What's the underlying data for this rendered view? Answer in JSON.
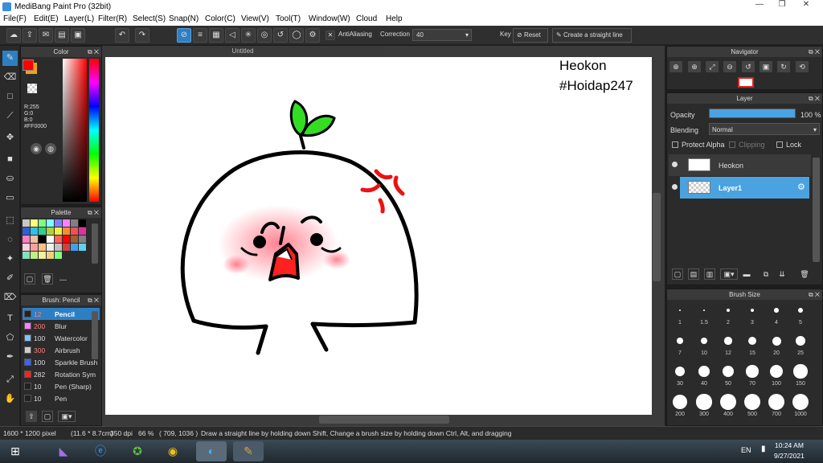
{
  "window": {
    "title": "MediBang Paint Pro (32bit)"
  },
  "menu": [
    "File(F)",
    "Edit(E)",
    "Layer(L)",
    "Filter(R)",
    "Select(S)",
    "Snap(N)",
    "Color(C)",
    "View(V)",
    "Tool(T)",
    "Window(W)",
    "Cloud",
    "Help"
  ],
  "toolbar": {
    "antialiasing": "AntiAliasing",
    "correction_label": "Correction",
    "correction_value": "40",
    "key": "Key",
    "reset": "Reset",
    "straight": "Create a straight line"
  },
  "color_panel": {
    "title": "Color",
    "r": "R:255",
    "g": "G:0",
    "b": "B:0",
    "hex": "#FF0000",
    "primary": "#ff0000",
    "secondary": "#f0a020"
  },
  "palette_panel": {
    "title": "Palette",
    "swatches": [
      "#c8c8c8",
      "#ffff80",
      "#80ff80",
      "#80ffff",
      "#8080ff",
      "#ff80ff",
      "#808080",
      "#000000",
      "#3060d0",
      "#30c0f0",
      "#30d090",
      "#b0d040",
      "#f0f040",
      "#f09030",
      "#f05050",
      "#e030a0",
      "#ff80c0",
      "#f0c0a0",
      "#000000",
      "#ffffff",
      "#ff6060",
      "#ff0000",
      "#a06030",
      "#808080",
      "#ffd0e0",
      "#ffa0a0",
      "#ffc080",
      "#f0f0f0",
      "#c0c0c0",
      "#d04040",
      "#40a0f0",
      "#60d0f0",
      "#80e0c0",
      "#c0f080",
      "#f0f0a0",
      "#f0d080",
      "#80ff80"
    ],
    "dash": "---"
  },
  "brush_panel": {
    "title": "Brush: Pencil",
    "brushes": [
      {
        "size": "12",
        "name": "Pencil",
        "color": "#222222"
      },
      {
        "size": "200",
        "name": "Blur",
        "color": "#ff80ff"
      },
      {
        "size": "100",
        "name": "Watercolor",
        "color": "#80c0ff"
      },
      {
        "size": "300",
        "name": "Airbrush",
        "color": "#cccccc"
      },
      {
        "size": "100",
        "name": "Sparkle Brush",
        "color": "#4060ff"
      },
      {
        "size": "282",
        "name": "Rotation Sym",
        "color": "#ff2020"
      },
      {
        "size": "10",
        "name": "Pen (Sharp)",
        "color": "#222222"
      },
      {
        "size": "10",
        "name": "Pen",
        "color": "#222222"
      }
    ]
  },
  "canvas": {
    "tab": "Untitled",
    "text_line1": "Heokon",
    "text_line2": "#Hoidap247"
  },
  "navigator": {
    "title": "Navigator"
  },
  "layer_panel": {
    "title": "Layer",
    "opacity_label": "Opacity",
    "opacity_value": "100 %",
    "opacity": 1.0,
    "blending_label": "Blending",
    "blending_value": "Normal",
    "protect_alpha": "Protect Alpha",
    "clipping": "Clipping",
    "lock": "Lock",
    "layers": [
      {
        "name": "Heokon"
      },
      {
        "name": "Layer1"
      }
    ]
  },
  "brushsize_panel": {
    "title": "Brush Size",
    "sizes": [
      "1",
      "1.5",
      "2",
      "3",
      "4",
      "5",
      "7",
      "10",
      "12",
      "15",
      "20",
      "25",
      "30",
      "40",
      "50",
      "70",
      "100",
      "150",
      "200",
      "300",
      "400",
      "500",
      "700",
      "1000"
    ]
  },
  "status": {
    "dims": "1600 * 1200 pixel",
    "cm": "(11.6 * 8.7cm)",
    "dpi": "350 dpi",
    "zoom": "66 %",
    "coords": "( 709, 1036 )",
    "hint": "Draw a straight line by holding down Shift, Change a brush size by holding down Ctrl, Alt, and dragging"
  },
  "taskbar": {
    "lang": "EN",
    "time": "10:24 AM",
    "date": "9/27/2021"
  }
}
